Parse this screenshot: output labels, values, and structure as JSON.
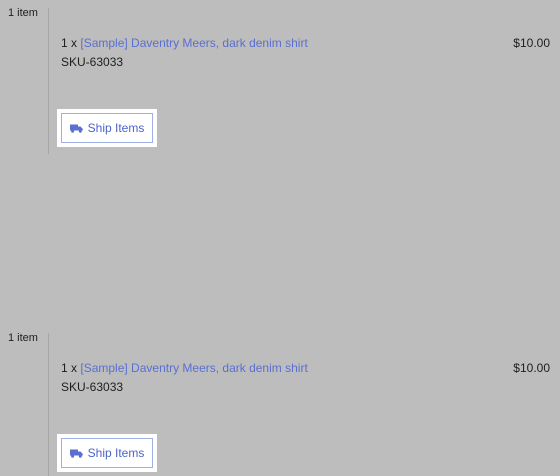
{
  "colors": {
    "background": "#bdbdbd",
    "link": "#5a6fd0",
    "button_text": "#4d63c9",
    "button_border": "#9fb0e6"
  },
  "shipments": [
    {
      "item_count": "1 item",
      "line_item": {
        "quantity": "1 x",
        "product_name": "[Sample] Daventry Meers, dark denim shirt",
        "sku": "SKU-63033",
        "price": "$10.00"
      },
      "ship_button": {
        "label": "Ship Items",
        "icon": "truck-icon"
      }
    },
    {
      "item_count": "1 item",
      "line_item": {
        "quantity": "1 x",
        "product_name": "[Sample] Daventry Meers, dark denim shirt",
        "sku": "SKU-63033",
        "price": "$10.00"
      },
      "ship_button": {
        "label": "Ship Items",
        "icon": "truck-icon"
      }
    }
  ]
}
